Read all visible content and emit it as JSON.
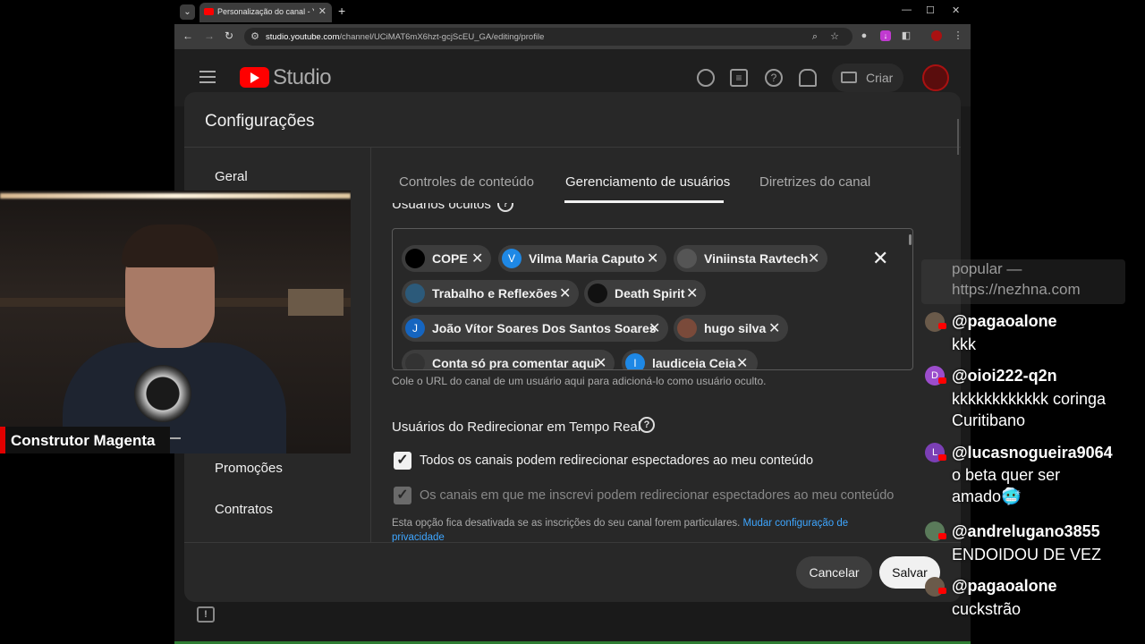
{
  "browser": {
    "tab_title": "Personalização do canal - YouTube",
    "url_domain": "studio.youtube.com",
    "url_path": "/channel/UCiMAT6mX6hzt-gcjScEU_GA/editing/profile"
  },
  "studio": {
    "logo_text": "Studio",
    "create_label": "Criar"
  },
  "modal": {
    "title": "Configurações",
    "sidebar": [
      "Geral",
      "Promoções",
      "Contratos"
    ],
    "tabs": [
      "Controles de conteúdo",
      "Gerenciamento de usuários",
      "Diretrizes do canal"
    ],
    "active_tab": "Gerenciamento de usuários",
    "hidden_users_heading": "Usuários ocultos",
    "hidden_users": [
      {
        "name": "COPE",
        "avatar_letter": "",
        "avatar_color": "#000000"
      },
      {
        "name": "Vilma Maria Caputo",
        "avatar_letter": "V",
        "avatar_color": "#1e88e5"
      },
      {
        "name": "Viniinsta Ravtech",
        "avatar_letter": "",
        "avatar_color": "#555555"
      },
      {
        "name": "Trabalho e Reflexões",
        "avatar_letter": "",
        "avatar_color": "#2c5a7a"
      },
      {
        "name": "Death Spirit",
        "avatar_letter": "",
        "avatar_color": "#111111"
      },
      {
        "name": "João Vítor Soares Dos Santos Soares",
        "avatar_letter": "J",
        "avatar_color": "#1565c0"
      },
      {
        "name": "hugo silva",
        "avatar_letter": "",
        "avatar_color": "#7a4a3a"
      },
      {
        "name": "Conta só pra comentar aqui",
        "avatar_letter": "",
        "avatar_color": "#333333"
      },
      {
        "name": "laudiceia Ceia",
        "avatar_letter": "l",
        "avatar_color": "#1e88e5"
      }
    ],
    "hidden_users_hint": "Cole o URL do canal de um usuário aqui para adicioná-lo como usuário oculto.",
    "redirect_heading": "Usuários do Redirecionar em Tempo Real",
    "redirect_options": [
      {
        "label": "Todos os canais podem redirecionar espectadores ao meu conteúdo",
        "checked": true,
        "disabled": false
      },
      {
        "label": "Os canais em que me inscrevi podem redirecionar espectadores ao meu conteúdo",
        "checked": true,
        "disabled": true
      }
    ],
    "note_text": "Esta opção fica desativada se as inscrições do seu canal forem particulares. ",
    "note_link": "Mudar configuração de privacidade",
    "cancel_label": "Cancelar",
    "save_label": "Salvar"
  },
  "webcam": {
    "streamer_name": "Construtor Magenta"
  },
  "chat": {
    "faded_lines": [
      "popular —",
      "https://nezhna.com"
    ],
    "messages": [
      {
        "user": "@pagaoalone",
        "text": [
          "kkk"
        ],
        "avatar_letter": "",
        "avatar_color": "#6a5a4a"
      },
      {
        "user": "@oioi222-q2n",
        "text": [
          "kkkkkkkkkkkk coringa",
          "Curitibano"
        ],
        "avatar_letter": "D",
        "avatar_color": "#9c4dcc"
      },
      {
        "user": "@lucasnogueira9064",
        "text": [
          "o beta quer ser",
          "amado🥶"
        ],
        "avatar_letter": "L",
        "avatar_color": "#7b3fb5"
      },
      {
        "user": "@andrelugano3855",
        "text": [
          "ENDOIDOU DE VEZ"
        ],
        "avatar_letter": "",
        "avatar_color": "#5a7a5a"
      },
      {
        "user": "@pagaoalone",
        "text": [
          "cuckstrão"
        ],
        "avatar_letter": "",
        "avatar_color": "#6a5a4a"
      }
    ]
  },
  "colors": {
    "accent_red": "#ff0000",
    "link_blue": "#3ea6ff",
    "modal_bg": "#282828"
  }
}
